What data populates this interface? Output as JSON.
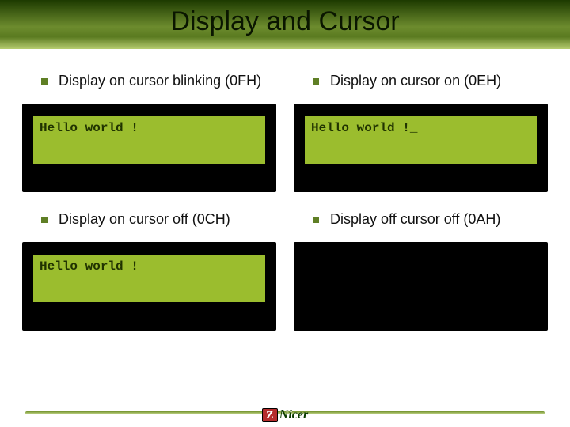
{
  "title": "Display and Cursor",
  "cells": [
    {
      "label": "Display on cursor blinking (0FH)",
      "lcd": "Hello world !"
    },
    {
      "label": "Display on cursor on (0EH)",
      "lcd": "Hello world !_"
    },
    {
      "label": "Display on cursor off (0CH)",
      "lcd": "Hello world !"
    },
    {
      "label": "Display off cursor off (0AH)",
      "lcd": ""
    }
  ],
  "footer": {
    "z": "Z",
    "brand": "Nicer"
  }
}
